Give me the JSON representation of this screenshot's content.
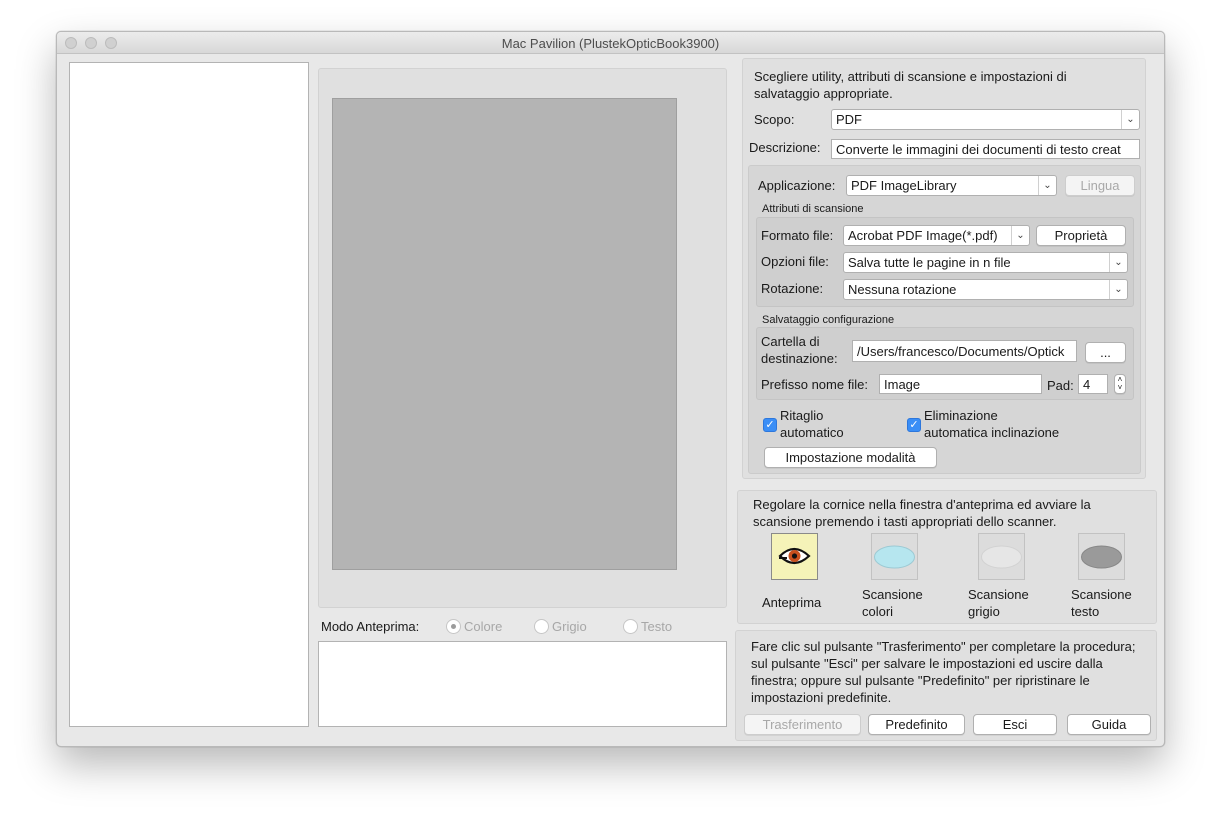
{
  "window": {
    "title": "Mac Pavilion (PlustekOpticBook3900)"
  },
  "utility": {
    "intro": "Scegliere utility, attributi di scansione e impostazioni di salvataggio appropriate.",
    "scopo_label": "Scopo:",
    "scopo_value": "PDF",
    "descrizione_label": "Descrizione:",
    "descrizione_value": "Converte le immagini dei documenti di testo creat",
    "applicazione_label": "Applicazione:",
    "applicazione_value": "PDF ImageLibrary",
    "lingua_button": "Lingua",
    "attributi_title": "Attributi di scansione",
    "formato_label": "Formato file:",
    "formato_value": "Acrobat PDF Image(*.pdf)",
    "proprieta_button": "Proprietà",
    "opzioni_label": "Opzioni file:",
    "opzioni_value": "Salva tutte le pagine in n file",
    "rotazione_label": "Rotazione:",
    "rotazione_value": "Nessuna rotazione",
    "salvataggio_title": "Salvataggio configurazione",
    "cartella_label_1": "Cartella di",
    "cartella_label_2": "destinazione:",
    "cartella_value": "/Users/francesco/Documents/Optick",
    "browse_button": "...",
    "prefisso_label": "Prefisso nome file:",
    "prefisso_value": "Image",
    "pad_label": "Pad:",
    "pad_value": "4",
    "ritaglio_1": "Ritaglio",
    "ritaglio_2": "automatico",
    "elimin_1": "Eliminazione",
    "elimin_2": "automatica inclinazione",
    "modalita_button": "Impostazione modalità"
  },
  "scan": {
    "intro": "Regolare la cornice nella finestra d'anteprima ed avviare la scansione premendo i tasti appropriati dello scanner.",
    "anteprima": "Anteprima",
    "colori_1": "Scansione",
    "colori_2": "colori",
    "grigio_1": "Scansione",
    "grigio_2": "grigio",
    "testo_1": "Scansione",
    "testo_2": "testo"
  },
  "preview_mode": {
    "label": "Modo Anteprima:",
    "colore": "Colore",
    "grigio": "Grigio",
    "testo": "Testo"
  },
  "footer": {
    "text": "Fare clic sul pulsante \"Trasferimento\" per completare la procedura; sul pulsante \"Esci\" per salvare le impostazioni ed uscire dalla finestra; oppure sul pulsante \"Predefinito\" per ripristinare le impostazioni predefinite.",
    "trasferimento": "Trasferimento",
    "predefinito": "Predefinito",
    "esci": "Esci",
    "guida": "Guida"
  },
  "colors": {
    "checkbox_accent": "#3a8ef6",
    "preview_gray": "#b4b4b4",
    "colori_icon": "#b6e6ef"
  }
}
